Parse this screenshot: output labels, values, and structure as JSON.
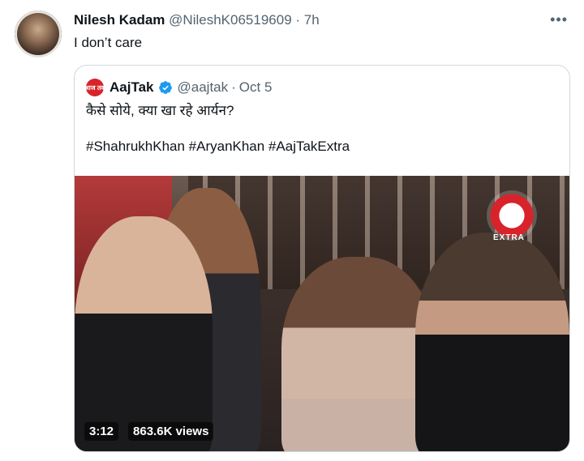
{
  "tweet": {
    "author": {
      "display_name": "Nilesh Kadam",
      "handle": "@NileshK06519609",
      "time": "7h"
    },
    "separator": "·",
    "more_icon": "more-horizontal-icon",
    "text": "I don’t care"
  },
  "quote": {
    "author": {
      "logo_text": "आज तक",
      "display_name": "AajTak",
      "handle": "@aajtak",
      "time": "Oct 5"
    },
    "separator": "·",
    "text": "कैसे सोये, क्या खा रहे आर्यन?\n\n#ShahrukhKhan #AryanKhan #AajTakExtra",
    "video": {
      "duration": "3:12",
      "views": "863.6K views",
      "watermark_text": "EXTRA"
    }
  },
  "colors": {
    "text_primary": "#0f1419",
    "text_secondary": "#536471",
    "border": "#cfd9de",
    "verified_blue": "#1d9bf0",
    "aajtak_red": "#d8232a"
  }
}
